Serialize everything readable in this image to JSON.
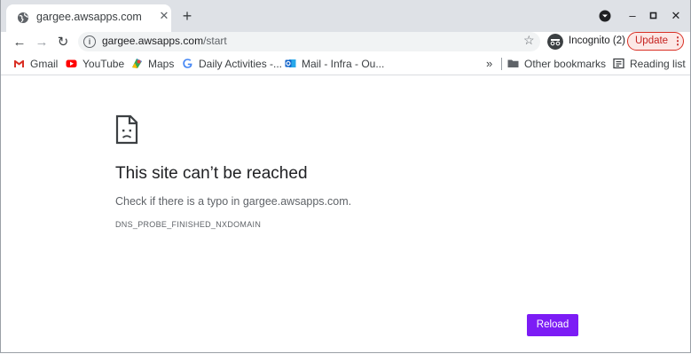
{
  "tab": {
    "title": "gargee.awsapps.com",
    "close_icon": "close-icon"
  },
  "toolbar": {
    "url_host": "gargee.awsapps.com",
    "url_path": "/start",
    "incognito_label": "Incognito (2)",
    "update_label": "Update"
  },
  "bookmarks": {
    "items": [
      "Gmail",
      "YouTube",
      "Maps",
      "Daily Activities -...",
      "Mail - Infra - Ou..."
    ],
    "overflow": "»",
    "other": "Other bookmarks",
    "reading_list": "Reading list"
  },
  "error": {
    "title": "This site can’t be reached",
    "description": "Check if there is a typo in gargee.awsapps.com.",
    "code": "DNS_PROBE_FINISHED_NXDOMAIN",
    "reload_label": "Reload"
  },
  "colors": {
    "accent": "#7c1cf5",
    "update_border": "#d93025"
  }
}
